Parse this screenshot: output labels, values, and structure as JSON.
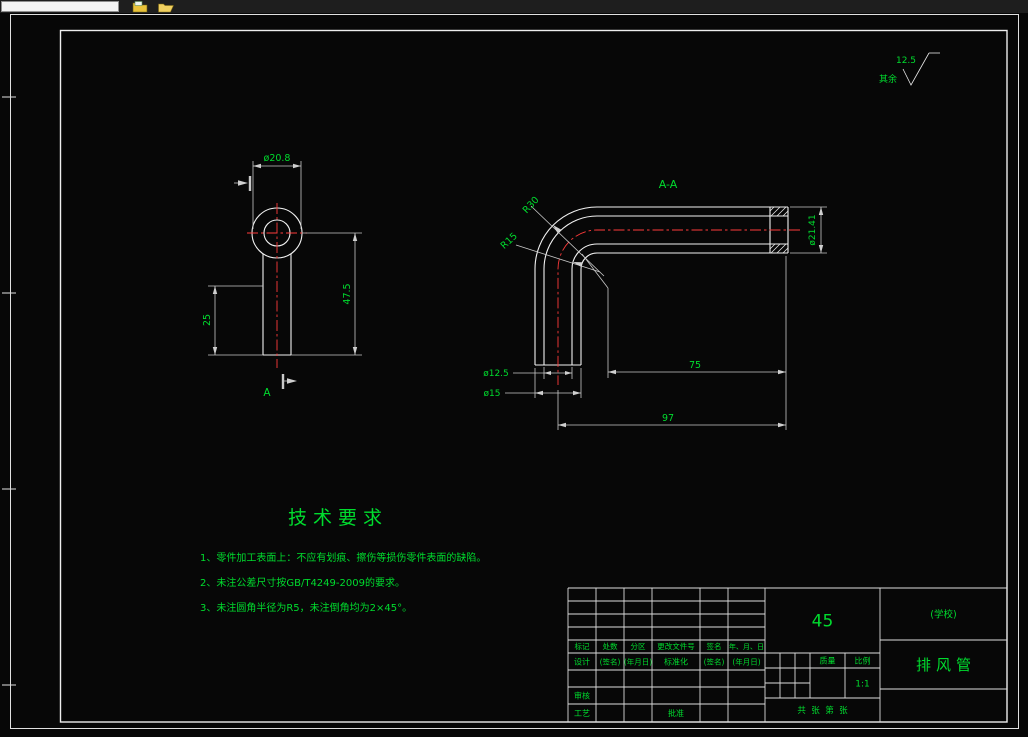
{
  "toolbar": {
    "combo_value": ""
  },
  "surface_finish": {
    "value": "12.5",
    "note": "其余"
  },
  "front_view": {
    "dim_diameter": "ø20.8",
    "dim_height": "47.5",
    "dim_offset": "25",
    "section_label": "A"
  },
  "section_view": {
    "label": "A-A",
    "radius_outer": "R30",
    "radius_inner": "R15",
    "dim_flange_od": "ø21.41",
    "dim_bore": "ø12.5",
    "dim_od": "ø15",
    "dim_length": "75",
    "dim_total": "97"
  },
  "tech_req": {
    "title": "技术要求",
    "item1": "1、零件加工表面上：不应有划痕、擦伤等损伤零件表面的缺陷。",
    "item2": "2、未注公差尺寸按GB/T4249-2009的要求。",
    "item3": "3、未注圆角半径为R5，未注倒角均为2×45°。"
  },
  "title_block": {
    "material": "45",
    "school": "(学校)",
    "part_name": "排风管",
    "rev": {
      "mark": "标记",
      "count": "处数",
      "zone": "分区",
      "doc": "更改文件号",
      "sign": "签名",
      "date": "年、月、日"
    },
    "sig": {
      "design": "设计",
      "signname": "(签名)",
      "signdate": "(年月日)",
      "standard": "标准化",
      "signname2": "(签名)",
      "signdate2": "(年月日)",
      "check": "审核",
      "process": "工艺",
      "approve": "批准"
    },
    "quality": "质量",
    "scale": "比例",
    "scale_value": "1:1",
    "sheets": "共  张  第  张"
  },
  "colors": {
    "background": "#070707",
    "line_white": "#f2f2f2",
    "dimension_gray": "#c9c9c9",
    "text_green": "#00dc2e",
    "centerline_red": "#ff3b3b",
    "icon_yellow": "#e8c23a"
  }
}
